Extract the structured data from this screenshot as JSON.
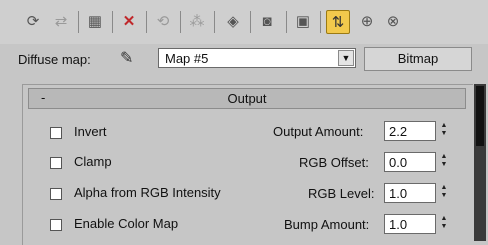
{
  "toolbar": {
    "buttons": [
      {
        "icon": "get-material-icon",
        "glyph": "⟳",
        "state": "normal"
      },
      {
        "icon": "put-to-scene-icon",
        "glyph": "⇄",
        "state": "disabled"
      },
      {
        "icon": "assign-material-icon",
        "glyph": "▦",
        "state": "normal"
      },
      {
        "icon": "reset-map-icon",
        "glyph": "✕",
        "state": "normal"
      },
      {
        "icon": "copy-material-icon",
        "glyph": "⟲",
        "state": "disabled"
      },
      {
        "icon": "make-unique-icon",
        "glyph": "⁂",
        "state": "disabled"
      },
      {
        "icon": "put-to-library-icon",
        "glyph": "◈",
        "state": "normal"
      },
      {
        "icon": "material-id-channel-icon",
        "glyph": "◙",
        "state": "normal"
      },
      {
        "icon": "show-map-in-viewport-icon",
        "glyph": "▣",
        "state": "normal"
      },
      {
        "icon": "show-end-result-icon",
        "glyph": "⇅",
        "state": "active"
      },
      {
        "icon": "go-to-parent-icon",
        "glyph": "⊕",
        "state": "normal"
      },
      {
        "icon": "go-forward-to-sibling-icon",
        "glyph": "⊗",
        "state": "normal"
      }
    ]
  },
  "map_row": {
    "label": "Diffuse map:",
    "eyedropper_icon": "eyedropper-icon",
    "map_name": "Map #5",
    "map_type_button": "Bitmap"
  },
  "rollout": {
    "collapse_symbol": "-",
    "title": "Output"
  },
  "checkboxes": [
    {
      "label": "Invert",
      "checked": false
    },
    {
      "label": "Clamp",
      "checked": false
    },
    {
      "label": "Alpha from RGB Intensity",
      "checked": false
    },
    {
      "label": "Enable Color Map",
      "checked": false
    }
  ],
  "spinners": [
    {
      "label": "Output Amount:",
      "value": "2.2"
    },
    {
      "label": "RGB Offset:",
      "value": "0.0"
    },
    {
      "label": "RGB Level:",
      "value": "1.0"
    },
    {
      "label": "Bump Amount:",
      "value": "1.0"
    }
  ],
  "spinner_arrows": {
    "up": "▲",
    "down": "▼"
  },
  "colors": {
    "active_button": "#f2c94c",
    "background": "#c6c6c6"
  }
}
